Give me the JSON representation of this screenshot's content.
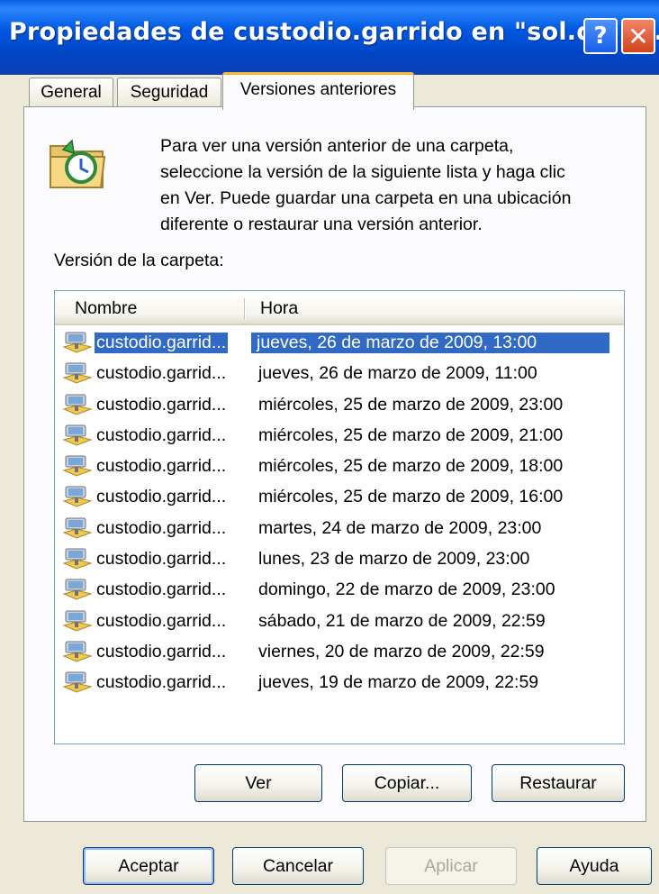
{
  "window": {
    "title": "Propiedades de custodio.garrido en \"sol.da.ua...",
    "help_button": "?",
    "close_button": "✕"
  },
  "tabs": [
    {
      "label": "General"
    },
    {
      "label": "Seguridad"
    },
    {
      "label": "Versiones anteriores",
      "active": true
    }
  ],
  "description": {
    "lines": [
      "Para ver una versión anterior de una carpeta,",
      "seleccione la versión de la siguiente lista y haga clic",
      "en Ver.  Puede guardar una carpeta en una ubicación",
      "diferente o restaurar una versión anterior."
    ]
  },
  "list_label": "Versión de la carpeta:",
  "list": {
    "columns": {
      "nombre": "Nombre",
      "hora": "Hora"
    },
    "rows": [
      {
        "name": "custodio.garrid...",
        "time": "jueves, 26 de marzo de 2009, 13:00",
        "selected": true
      },
      {
        "name": "custodio.garrid...",
        "time": "jueves, 26 de marzo de 2009, 11:00"
      },
      {
        "name": "custodio.garrid...",
        "time": "miércoles, 25 de marzo de 2009, 23:00"
      },
      {
        "name": "custodio.garrid...",
        "time": "miércoles, 25 de marzo de 2009, 21:00"
      },
      {
        "name": "custodio.garrid...",
        "time": "miércoles, 25 de marzo de 2009, 18:00"
      },
      {
        "name": "custodio.garrid...",
        "time": "miércoles, 25 de marzo de 2009, 16:00"
      },
      {
        "name": "custodio.garrid...",
        "time": "martes, 24 de marzo de 2009, 23:00"
      },
      {
        "name": "custodio.garrid...",
        "time": "lunes, 23 de marzo de 2009, 23:00"
      },
      {
        "name": "custodio.garrid...",
        "time": "domingo, 22 de marzo de 2009, 23:00"
      },
      {
        "name": "custodio.garrid...",
        "time": "sábado, 21 de marzo de 2009, 22:59"
      },
      {
        "name": "custodio.garrid...",
        "time": "viernes, 20 de marzo de 2009, 22:59"
      },
      {
        "name": "custodio.garrid...",
        "time": "jueves, 19 de marzo de 2009, 22:59"
      }
    ]
  },
  "actions": {
    "ver": "Ver",
    "copiar": "Copiar...",
    "restaurar": "Restaurar"
  },
  "footer": {
    "aceptar": "Aceptar",
    "cancelar": "Cancelar",
    "aplicar": "Aplicar",
    "ayuda": "Ayuda"
  },
  "colors": {
    "selection": "#316ac5",
    "titlebar": "#0058e0",
    "tab_highlight": "#f7b631"
  },
  "icons": {
    "folder": "folder-history-icon",
    "row": "network-share-icon"
  }
}
